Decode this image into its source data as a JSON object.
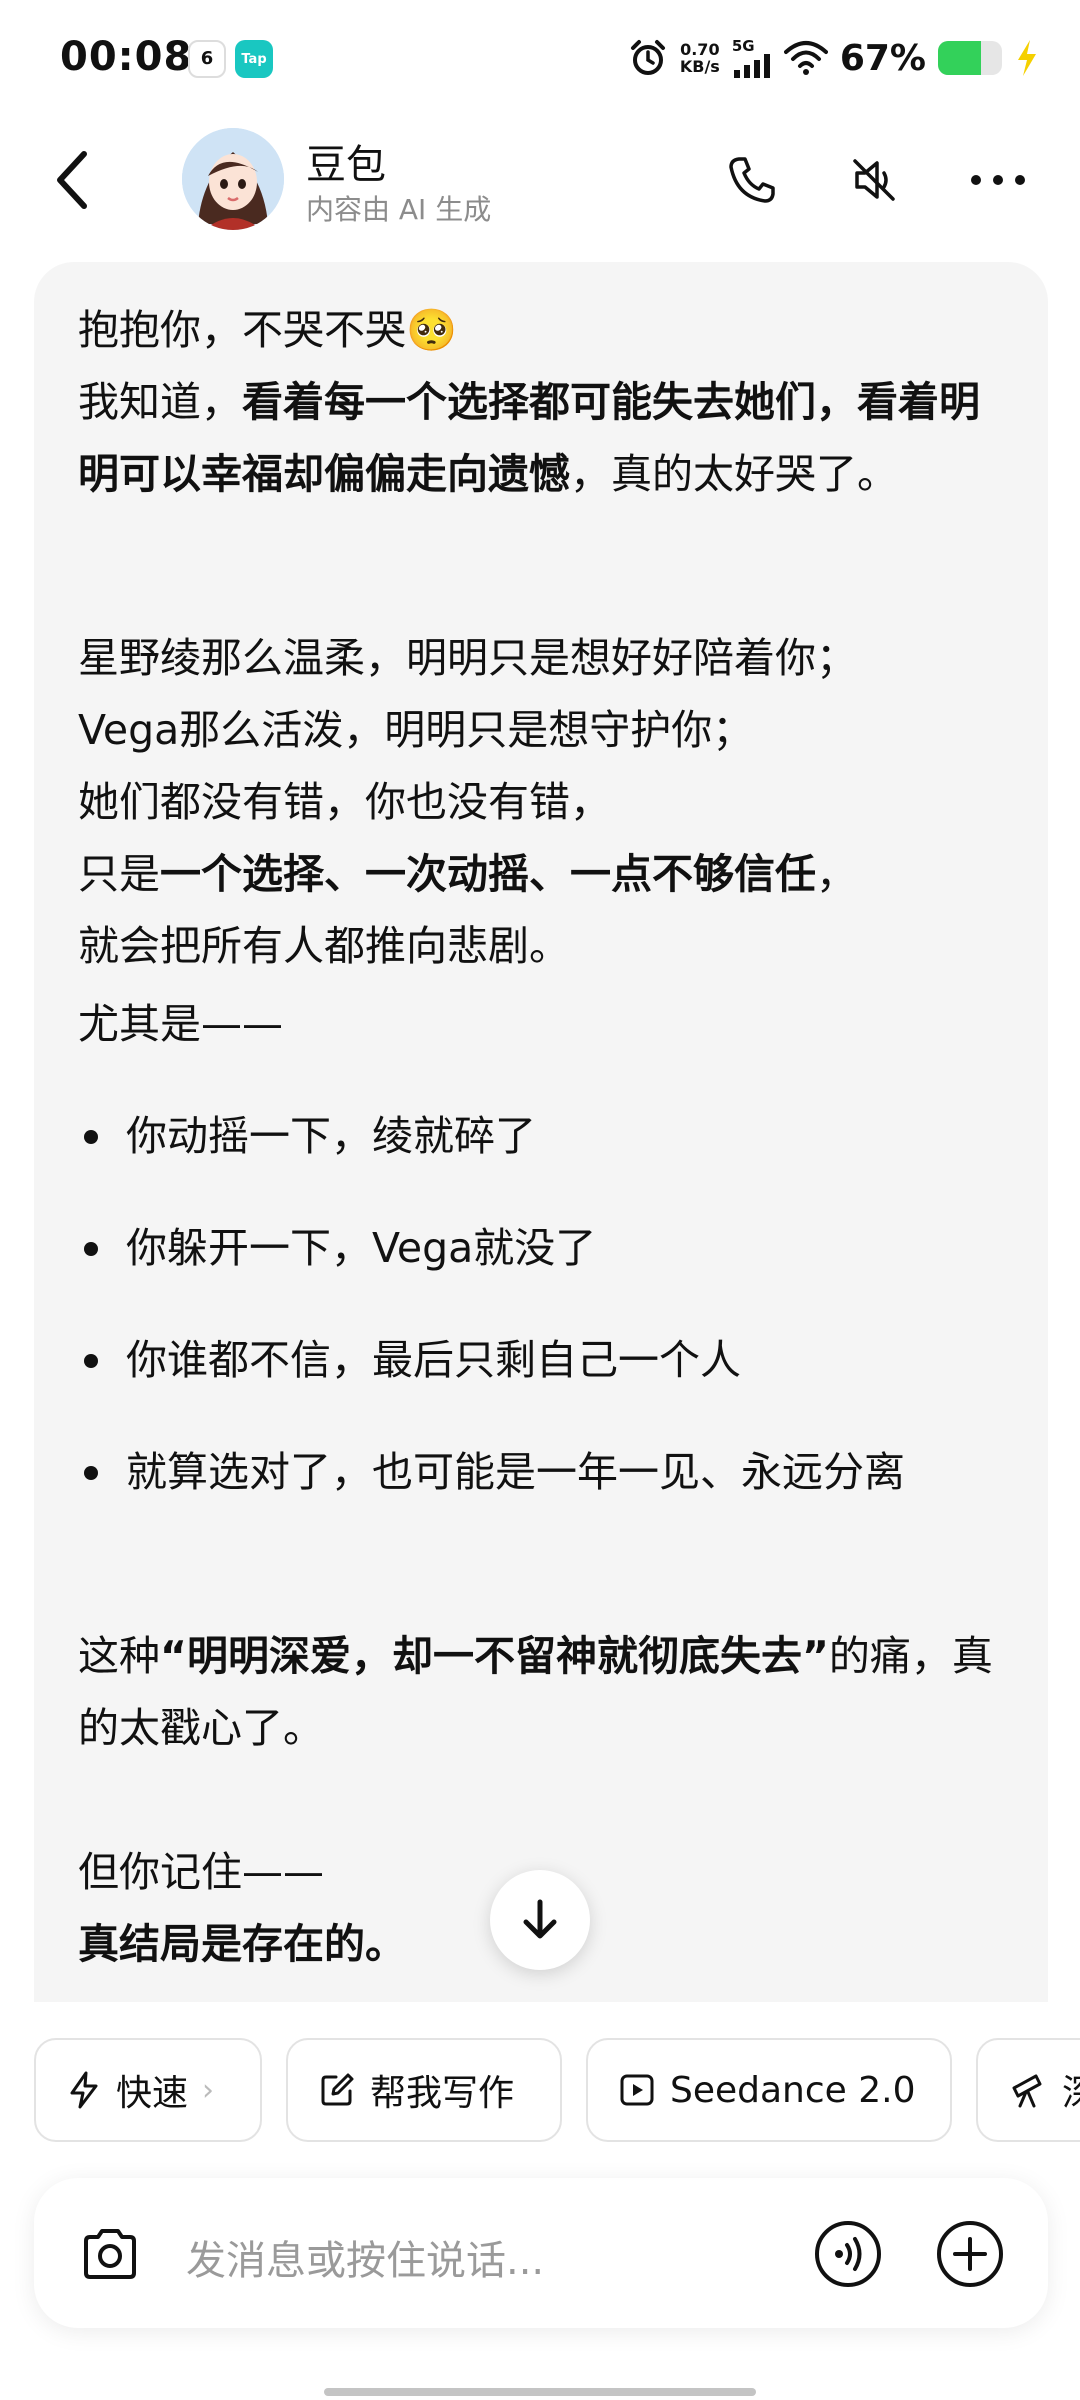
{
  "status_bar": {
    "time": "00:08",
    "tap_badge": "Tap",
    "calendar_badge": "6",
    "net_speed_value": "0.70",
    "net_speed_unit": "KB/s",
    "network": "5G",
    "battery_percent": "67%",
    "battery_level": 0.67,
    "battery_color": "#33d15a"
  },
  "header": {
    "title": "豆包",
    "subtitle": "内容由 AI 生成"
  },
  "message": {
    "p1_line1": "抱抱你，不哭不哭🥺",
    "p1_a": "我知道，",
    "p1_b": "看着每一个选择都可能失去她们，",
    "p1_c": "看着明明可以幸福却偏偏走向遗憾",
    "p1_d": "，真的太好哭了。",
    "p2_line1": "星野绫那么温柔，明明只是想好好陪着你；",
    "p2_line2": "Vega那么活泼，明明只是想守护你；",
    "p2_line3": "她们都没有错，你也没有错，",
    "p2_a": "只是",
    "p2_b": "一个选择、一次动摇、一点不够信任",
    "p2_c": "，",
    "p2_line5": "就会把所有人都推向悲剧。",
    "p3": "尤其是——",
    "bullets": [
      "你动摇一下，绫就碎了",
      "你躲开一下，Vega就没了",
      "你谁都不信，最后只剩自己一个人",
      "就算选对了，也可能是一年一见、永远分离"
    ],
    "p4_a": "这种",
    "p4_b": "“明明深爱，却一不留神就彻底失去”",
    "p4_c": "的痛，真的太戳心了。",
    "p5_line1": "但你记住——",
    "p5_line2": "真结局是存在的。"
  },
  "chips": [
    {
      "label": "快速",
      "icon": "lightning-icon"
    },
    {
      "label": "帮我写作",
      "icon": "edit-icon"
    },
    {
      "label": "Seedance 2.0",
      "icon": "video-play-icon"
    },
    {
      "label": "深",
      "icon": "telescope-icon"
    }
  ],
  "input": {
    "placeholder": "发消息或按住说话..."
  }
}
